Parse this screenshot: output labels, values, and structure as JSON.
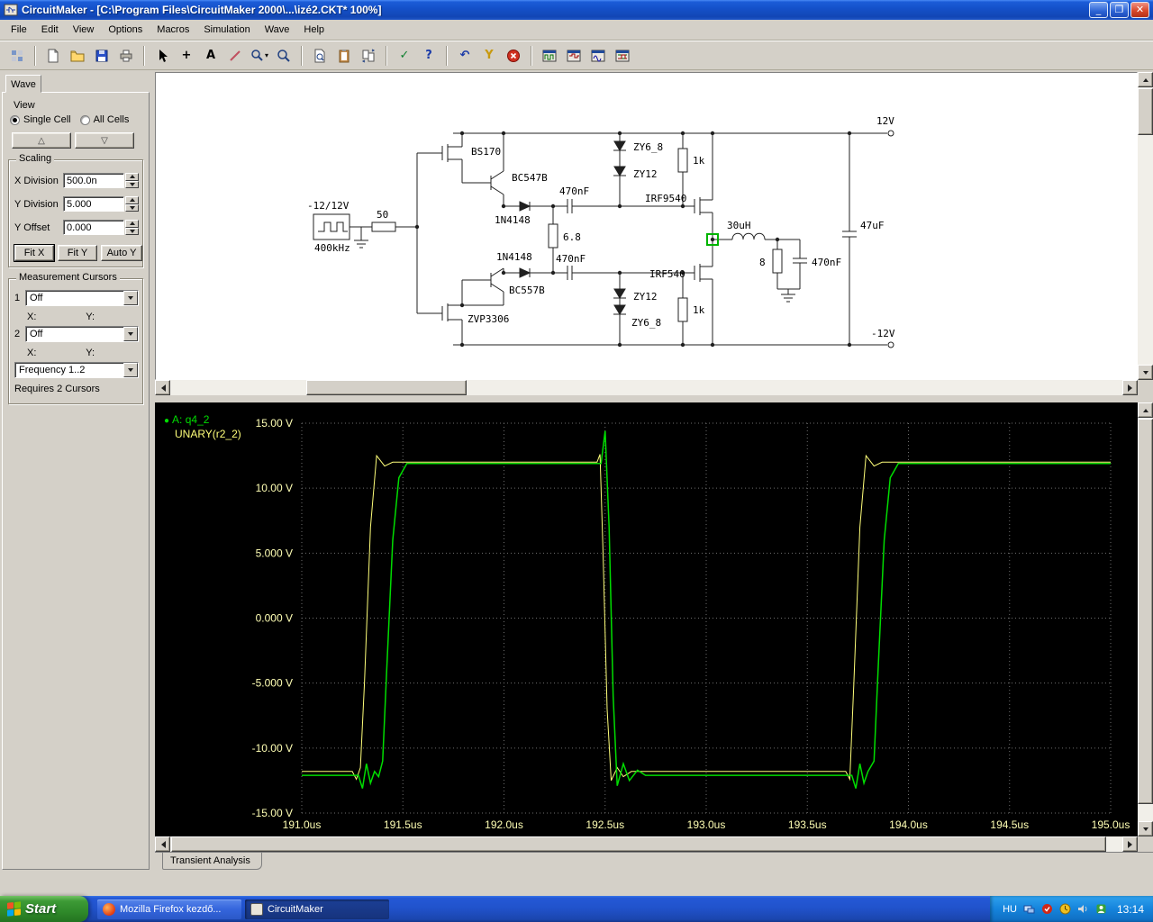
{
  "window": {
    "title": "CircuitMaker - [C:\\Program Files\\CircuitMaker 2000\\...\\izé2.CKT* 100%]"
  },
  "menu": {
    "items": [
      "File",
      "Edit",
      "View",
      "Options",
      "Macros",
      "Simulation",
      "Wave",
      "Help"
    ]
  },
  "toolbar": {
    "icons": [
      "library-browse-icon",
      "new-file-icon",
      "open-file-icon",
      "save-icon",
      "print-icon",
      "arrow-tool-icon",
      "place-part-icon",
      "text-tool-icon",
      "delete-tool-icon",
      "zoom-select-icon",
      "zoom-window-icon",
      "find-part-icon",
      "clipboard-icon",
      "compare-windows-icon",
      "rules-check-icon",
      "help-icon",
      "undo-icon",
      "probe-tool-icon",
      "stop-simulation-icon",
      "scope-window-1-icon",
      "scope-window-2-icon",
      "scope-window-3-icon",
      "scope-window-4-icon"
    ],
    "glyphs": {
      "plus": "+",
      "text": "A",
      "check": "✓",
      "help": "?",
      "undo": "↶",
      "probe": "Y",
      "caret": "▾"
    }
  },
  "wave_panel": {
    "tab_label": "Wave",
    "view": {
      "label": "View",
      "options": [
        {
          "label": "Single Cell",
          "selected": true
        },
        {
          "label": "All Cells",
          "selected": false
        }
      ],
      "up_button": "△",
      "down_button": "▽"
    },
    "scaling": {
      "label": "Scaling",
      "fields": [
        {
          "label": "X Division",
          "value": "500.0n"
        },
        {
          "label": "Y Division",
          "value": "5.000"
        },
        {
          "label": "Y Offset",
          "value": "0.000"
        }
      ],
      "buttons": [
        "Fit X",
        "Fit Y",
        "Auto Y"
      ]
    },
    "cursors": {
      "label": "Measurement Cursors",
      "rows": [
        {
          "index": "1",
          "value": "Off"
        },
        {
          "index": "2",
          "value": "Off"
        }
      ],
      "x_label": "X:",
      "y_label": "Y:",
      "function_value": "Frequency 1..2",
      "note": "Requires 2 Cursors"
    }
  },
  "schematic": {
    "labels": [
      "BS170",
      "BC547B",
      "-12/12V",
      "400kHz",
      "50",
      "1N4148",
      "470nF",
      "6.8",
      "1N4148",
      "BC557B",
      "470nF",
      "ZY6_8",
      "ZY12",
      "1k",
      "IRF9540",
      "IRF540",
      "ZY12",
      "1k",
      "ZY6_8",
      "ZVP3306",
      "30uH",
      "8",
      "470nF",
      "47uF",
      "12V",
      "-12V"
    ]
  },
  "chart_data": {
    "type": "line",
    "title": "",
    "xlabel": "time",
    "ylabel": "voltage",
    "xlim": [
      191.0,
      195.0
    ],
    "ylim": [
      -15,
      15
    ],
    "grid": "dotted",
    "legend_position": "top-left",
    "x_ticks": [
      191.0,
      191.5,
      192.0,
      192.5,
      193.0,
      193.5,
      194.0,
      194.5,
      195.0
    ],
    "x_tick_labels": [
      "191.0us",
      "191.5us",
      "192.0us",
      "192.5us",
      "193.0us",
      "193.5us",
      "194.0us",
      "194.5us",
      "195.0us"
    ],
    "y_ticks": [
      15,
      10,
      5,
      0,
      -5,
      -10,
      -15
    ],
    "y_tick_labels": [
      "15.00 V",
      "10.00 V",
      "5.000 V",
      "0.000 V",
      "-5.000 V",
      "-10.00 V",
      "-15.00 V"
    ],
    "legend": [
      {
        "label": "A: q4_2",
        "color": "#00dd00"
      },
      {
        "label": "UNARY(r2_2)",
        "color": "#ffff7a"
      }
    ],
    "series": [
      {
        "name": "q4_2",
        "color": "#00dd00",
        "width": 1.5,
        "points": [
          [
            191.0,
            -12.1
          ],
          [
            191.28,
            -12.1
          ],
          [
            191.3,
            -13.1
          ],
          [
            191.32,
            -11.2
          ],
          [
            191.34,
            -12.7
          ],
          [
            191.36,
            -11.8
          ],
          [
            191.38,
            -12.2
          ],
          [
            191.4,
            -11.0
          ],
          [
            191.42,
            -4.0
          ],
          [
            191.45,
            6.0
          ],
          [
            191.48,
            10.8
          ],
          [
            191.52,
            11.9
          ],
          [
            192.48,
            11.9
          ],
          [
            192.5,
            14.4
          ],
          [
            192.52,
            7.0
          ],
          [
            192.54,
            -6.0
          ],
          [
            192.56,
            -12.9
          ],
          [
            192.59,
            -11.2
          ],
          [
            192.62,
            -12.5
          ],
          [
            192.66,
            -11.7
          ],
          [
            192.7,
            -12.1
          ],
          [
            193.72,
            -12.1
          ],
          [
            193.74,
            -13.1
          ],
          [
            193.76,
            -11.2
          ],
          [
            193.78,
            -12.7
          ],
          [
            193.8,
            -11.8
          ],
          [
            193.83,
            -11.0
          ],
          [
            193.85,
            -4.0
          ],
          [
            193.88,
            6.0
          ],
          [
            193.91,
            10.8
          ],
          [
            193.95,
            11.9
          ],
          [
            195.0,
            11.9
          ]
        ]
      },
      {
        "name": "UNARY(r2_2)",
        "color": "#ffff7a",
        "width": 1,
        "points": [
          [
            191.0,
            -11.8
          ],
          [
            191.25,
            -11.8
          ],
          [
            191.27,
            -12.4
          ],
          [
            191.29,
            -11.5
          ],
          [
            191.31,
            -5.0
          ],
          [
            191.34,
            7.0
          ],
          [
            191.37,
            12.5
          ],
          [
            191.41,
            11.7
          ],
          [
            191.45,
            12.0
          ],
          [
            192.46,
            12.0
          ],
          [
            192.475,
            12.6
          ],
          [
            192.49,
            5.0
          ],
          [
            192.51,
            -7.0
          ],
          [
            192.53,
            -12.5
          ],
          [
            192.56,
            -11.5
          ],
          [
            192.59,
            -12.2
          ],
          [
            192.63,
            -11.8
          ],
          [
            193.69,
            -11.8
          ],
          [
            193.71,
            -12.4
          ],
          [
            193.73,
            -5.0
          ],
          [
            193.76,
            7.0
          ],
          [
            193.79,
            12.5
          ],
          [
            193.83,
            11.7
          ],
          [
            193.87,
            12.0
          ],
          [
            195.0,
            12.0
          ]
        ]
      }
    ]
  },
  "bottom_tab": "Transient Analysis",
  "taskbar": {
    "start_label": "Start",
    "tasks": [
      {
        "label": "Mozilla Firefox kezdő...",
        "icon": "firefox-icon",
        "active": false
      },
      {
        "label": "CircuitMaker",
        "icon": "circuitmaker-icon",
        "active": true
      }
    ],
    "language": "HU",
    "clock": "13:14"
  }
}
